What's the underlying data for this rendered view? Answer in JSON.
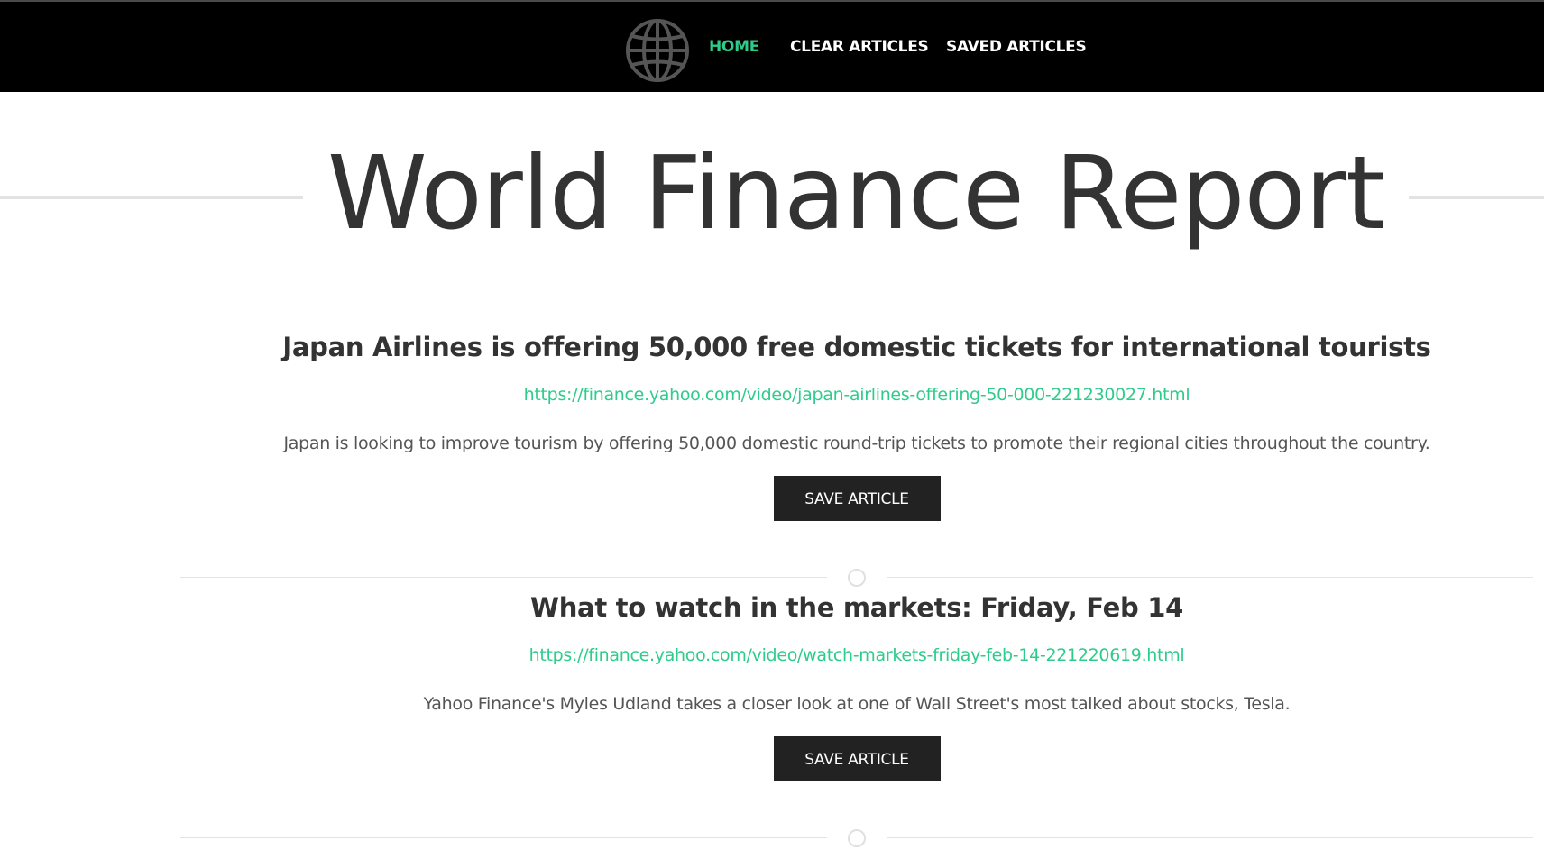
{
  "nav": {
    "logo_icon": "globe-icon",
    "items": [
      {
        "label": "HOME",
        "active": true
      },
      {
        "label": "CLEAR ARTICLES",
        "active": false
      },
      {
        "label": "SAVED ARTICLES",
        "active": false
      }
    ]
  },
  "hero": {
    "title": "World Finance Report"
  },
  "articles": [
    {
      "title": "Japan Airlines is offering 50,000 free domestic tickets for international tourists",
      "url": "https://finance.yahoo.com/video/japan-airlines-offering-50-000-221230027.html",
      "summary": "Japan is looking to improve tourism by offering 50,000 domestic round-trip tickets to promote their regional cities throughout the country.",
      "button_label": "SAVE ARTICLE"
    },
    {
      "title": "What to watch in the markets: Friday, Feb 14",
      "url": "https://finance.yahoo.com/video/watch-markets-friday-feb-14-221220619.html",
      "summary": "Yahoo Finance's Myles Udland takes a closer look at one of Wall Street's most talked about stocks, Tesla.",
      "button_label": "SAVE ARTICLE"
    }
  ],
  "colors": {
    "accent": "#2ecc8b",
    "navbar_bg": "#000000",
    "button_bg": "#222222",
    "text": "#333333"
  }
}
